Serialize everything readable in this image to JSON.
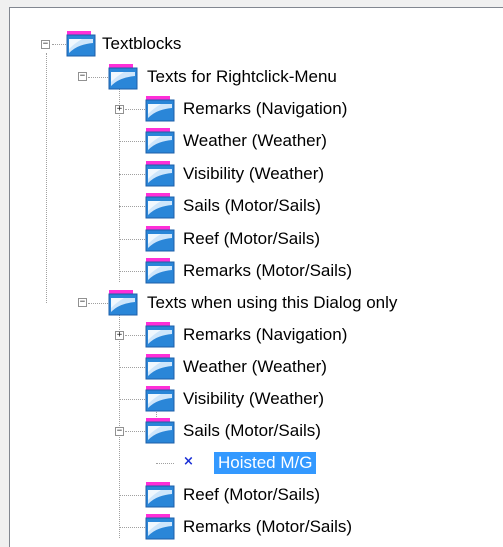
{
  "tree": {
    "root": {
      "label": "Textblocks",
      "icon": "folder-icon",
      "expanded": true,
      "children": [
        {
          "label": "Texts for Rightclick-Menu",
          "icon": "folder-icon",
          "expanded": true,
          "children": [
            {
              "label": "Remarks (Navigation)",
              "icon": "folder-icon",
              "expandable": true,
              "expanded": false
            },
            {
              "label": "Weather (Weather)",
              "icon": "folder-icon"
            },
            {
              "label": "Visibility (Weather)",
              "icon": "folder-icon"
            },
            {
              "label": "Sails (Motor/Sails)",
              "icon": "folder-icon"
            },
            {
              "label": "Reef (Motor/Sails)",
              "icon": "folder-icon"
            },
            {
              "label": "Remarks (Motor/Sails)",
              "icon": "folder-icon"
            }
          ]
        },
        {
          "label": "Texts when using this Dialog only",
          "icon": "folder-icon",
          "expanded": true,
          "children": [
            {
              "label": "Remarks (Navigation)",
              "icon": "folder-icon",
              "expandable": true,
              "expanded": false
            },
            {
              "label": "Weather (Weather)",
              "icon": "folder-icon"
            },
            {
              "label": "Visibility (Weather)",
              "icon": "folder-icon"
            },
            {
              "label": "Sails (Motor/Sails)",
              "icon": "folder-icon",
              "expandable": true,
              "expanded": true,
              "children": [
                {
                  "label": "Hoisted M/G",
                  "icon": "x-mark-icon",
                  "selected": true
                }
              ]
            },
            {
              "label": "Reef (Motor/Sails)",
              "icon": "folder-icon"
            },
            {
              "label": "Remarks (Motor/Sails)",
              "icon": "folder-icon"
            }
          ]
        }
      ]
    },
    "expander_collapsed_glyph": "+",
    "expander_expanded_glyph": "−",
    "item_mark_glyph": "×"
  },
  "colors": {
    "selection_bg": "#3399ff",
    "selection_text": "#ffffff",
    "folder_top": "#ff2fd8",
    "folder_body": "#2a86d8",
    "folder_light": "#cfe6fb",
    "item_mark": "#1a2fd6"
  }
}
